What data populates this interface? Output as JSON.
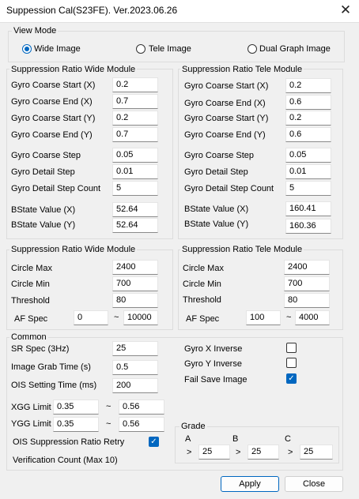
{
  "title": "Suppession Cal(S23FE). Ver.2023.06.26",
  "view_mode": {
    "title": "View Mode",
    "options": [
      "Wide Image",
      "Tele Image",
      "Dual Graph Image"
    ],
    "selected": "Wide Image"
  },
  "wide_ratio": {
    "title": "Suppression Ratio Wide Module",
    "gyro_coarse_start_x": {
      "label": "Gyro Coarse Start (X)",
      "value": "0.2"
    },
    "gyro_coarse_end_x": {
      "label": "Gyro Coarse End (X)",
      "value": "0.7"
    },
    "gyro_coarse_start_y": {
      "label": "Gyro Coarse Start (Y)",
      "value": "0.2"
    },
    "gyro_coarse_end_y": {
      "label": "Gyro Coarse End (Y)",
      "value": "0.7"
    },
    "gyro_coarse_step": {
      "label": "Gyro Coarse Step",
      "value": "0.05"
    },
    "gyro_detail_step": {
      "label": "Gyro Detail Step",
      "value": "0.01"
    },
    "gyro_detail_step_count": {
      "label": "Gyro Detail Step Count",
      "value": "5"
    },
    "bstate_x": {
      "label": "BState Value (X)",
      "value": "52.64"
    },
    "bstate_y": {
      "label": "BState Value (Y)",
      "value": "52.64"
    }
  },
  "tele_ratio": {
    "title": "Suppression Ratio Tele Module",
    "gyro_coarse_start_x": {
      "label": "Gyro Coarse Start (X)",
      "value": "0.2"
    },
    "gyro_coarse_end_x": {
      "label": "Gyro Coarse End (X)",
      "value": "0.6"
    },
    "gyro_coarse_start_y": {
      "label": "Gyro Coarse Start (Y)",
      "value": "0.2"
    },
    "gyro_coarse_end_y": {
      "label": "Gyro Coarse End (Y)",
      "value": "0.6"
    },
    "gyro_coarse_step": {
      "label": "Gyro Coarse Step",
      "value": "0.05"
    },
    "gyro_detail_step": {
      "label": "Gyro Detail Step",
      "value": "0.01"
    },
    "gyro_detail_step_count": {
      "label": "Gyro Detail Step Count",
      "value": "5"
    },
    "bstate_x": {
      "label": "BState Value (X)",
      "value": "160.41"
    },
    "bstate_y": {
      "label": "BState Value (Y)",
      "value": "160.36"
    }
  },
  "wide_circle": {
    "title": "Suppression Ratio Wide Module",
    "circle_max": {
      "label": "Circle Max",
      "value": "2400"
    },
    "circle_min": {
      "label": "Circle Min",
      "value": "700"
    },
    "threshold": {
      "label": "Threshold",
      "value": "80"
    },
    "af_spec": {
      "label": "AF Spec",
      "min": "0",
      "tilde": "~",
      "max": "10000"
    }
  },
  "tele_circle": {
    "title": "Suppression Ratio Tele Module",
    "circle_max": {
      "label": "Circle Max",
      "value": "2400"
    },
    "circle_min": {
      "label": "Circle Min",
      "value": "700"
    },
    "threshold": {
      "label": "Threshold",
      "value": "80"
    },
    "af_spec": {
      "label": "AF Spec",
      "min": "100",
      "tilde": "~",
      "max": "4000"
    }
  },
  "common": {
    "title": "Common",
    "sr_spec": {
      "label": "SR Spec (3Hz)",
      "value": "25"
    },
    "image_grab_time": {
      "label": "Image Grab Time (s)",
      "value": "0.5"
    },
    "ois_setting_time": {
      "label": "OIS Setting Time (ms)",
      "value": "200"
    },
    "xgg_limit": {
      "label": "XGG Limit",
      "min": "0.35",
      "tilde": "~",
      "max": "0.56"
    },
    "ygg_limit": {
      "label": "YGG Limit",
      "min": "0.35",
      "tilde": "~",
      "max": "0.56"
    },
    "ois_retry": {
      "label": "OIS Suppression Ratio Retry",
      "checked": true
    },
    "verification_count": {
      "label": "Verification Count (Max 10)"
    },
    "gyro_x_inverse": {
      "label": "Gyro X Inverse",
      "checked": false
    },
    "gyro_y_inverse": {
      "label": "Gyro Y Inverse",
      "checked": false
    },
    "fail_save_image": {
      "label": "Fail Save Image",
      "checked": true
    },
    "grade": {
      "title": "Grade",
      "items": [
        {
          "letter": "A",
          "op": ">",
          "value": "25"
        },
        {
          "letter": "B",
          "op": ">",
          "value": "25"
        },
        {
          "letter": "C",
          "op": ">",
          "value": "25"
        }
      ]
    }
  },
  "buttons": {
    "apply": "Apply",
    "close": "Close"
  },
  "icons": {
    "close": "close-icon",
    "check": "checkmark-icon"
  }
}
